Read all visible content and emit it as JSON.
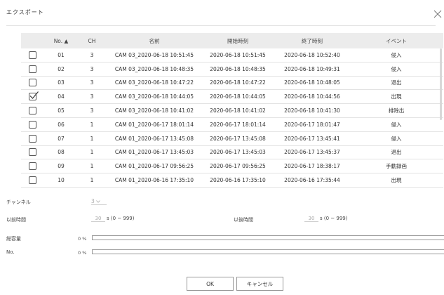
{
  "dialog": {
    "title": "エクスポート"
  },
  "table": {
    "headers": {
      "no": "No. ▲",
      "ch": "CH",
      "name": "名前",
      "start": "開始時刻",
      "end": "終了時刻",
      "event": "イベント"
    },
    "rows": [
      {
        "checked": false,
        "no": "01",
        "ch": "3",
        "name": "CAM 03_2020-06-18 10:51:45",
        "start": "2020-06-18 10:51:45",
        "end": "2020-06-18 10:52:40",
        "event": "侵入"
      },
      {
        "checked": false,
        "no": "02",
        "ch": "3",
        "name": "CAM 03_2020-06-18 10:48:35",
        "start": "2020-06-18 10:48:35",
        "end": "2020-06-18 10:49:31",
        "event": "侵入"
      },
      {
        "checked": false,
        "no": "03",
        "ch": "3",
        "name": "CAM 03_2020-06-18 10:47:22",
        "start": "2020-06-18 10:47:22",
        "end": "2020-06-18 10:48:05",
        "event": "退出"
      },
      {
        "checked": true,
        "no": "04",
        "ch": "3",
        "name": "CAM 03_2020-06-18 10:44:05",
        "start": "2020-06-18 10:44:05",
        "end": "2020-06-18 10:44:56",
        "event": "出現"
      },
      {
        "checked": false,
        "no": "05",
        "ch": "3",
        "name": "CAM 03_2020-06-18 10:41:02",
        "start": "2020-06-18 10:41:02",
        "end": "2020-06-18 10:41:30",
        "event": "排除出"
      },
      {
        "checked": false,
        "no": "06",
        "ch": "1",
        "name": "CAM 01_2020-06-17 18:01:14",
        "start": "2020-06-17 18:01:14",
        "end": "2020-06-17 18:01:47",
        "event": "侵入"
      },
      {
        "checked": false,
        "no": "07",
        "ch": "1",
        "name": "CAM 01_2020-06-17 13:45:08",
        "start": "2020-06-17 13:45:08",
        "end": "2020-06-17 13:45:41",
        "event": "侵入"
      },
      {
        "checked": false,
        "no": "08",
        "ch": "1",
        "name": "CAM 01_2020-06-17 13:45:03",
        "start": "2020-06-17 13:45:03",
        "end": "2020-06-17 13:45:37",
        "event": "退出"
      },
      {
        "checked": false,
        "no": "09",
        "ch": "1",
        "name": "CAM 01_2020-06-17 09:56:25",
        "start": "2020-06-17 09:56:25",
        "end": "2020-06-17 18:38:17",
        "event": "手動録画"
      },
      {
        "checked": false,
        "no": "10",
        "ch": "1",
        "name": "CAM 01_2020-06-16 17:35:10",
        "start": "2020-06-16 17:35:10",
        "end": "2020-06-16 17:35:44",
        "event": "出現"
      }
    ]
  },
  "channel": {
    "label": "チャンネル",
    "value": "3"
  },
  "before_time": {
    "label": "以前時間",
    "value": "30",
    "unit": "s (0 ~ 999)"
  },
  "after_time": {
    "label": "以後時間",
    "value": "30",
    "unit": "s (0 ~ 999)"
  },
  "total_capacity": {
    "label": "総容量",
    "percent_text": "0 %",
    "progress": 0
  },
  "no_progress": {
    "label": "No.",
    "percent_text": "0 %",
    "progress": 0
  },
  "buttons": {
    "ok": "OK",
    "cancel": "キャンセル"
  },
  "icons": {
    "close": "close-icon",
    "checkbox": "checkbox-icon",
    "dropdown": "chevron-down-icon"
  },
  "colors": {
    "progress_fill": "#6f8fd0",
    "header_bg": "#ececec"
  }
}
